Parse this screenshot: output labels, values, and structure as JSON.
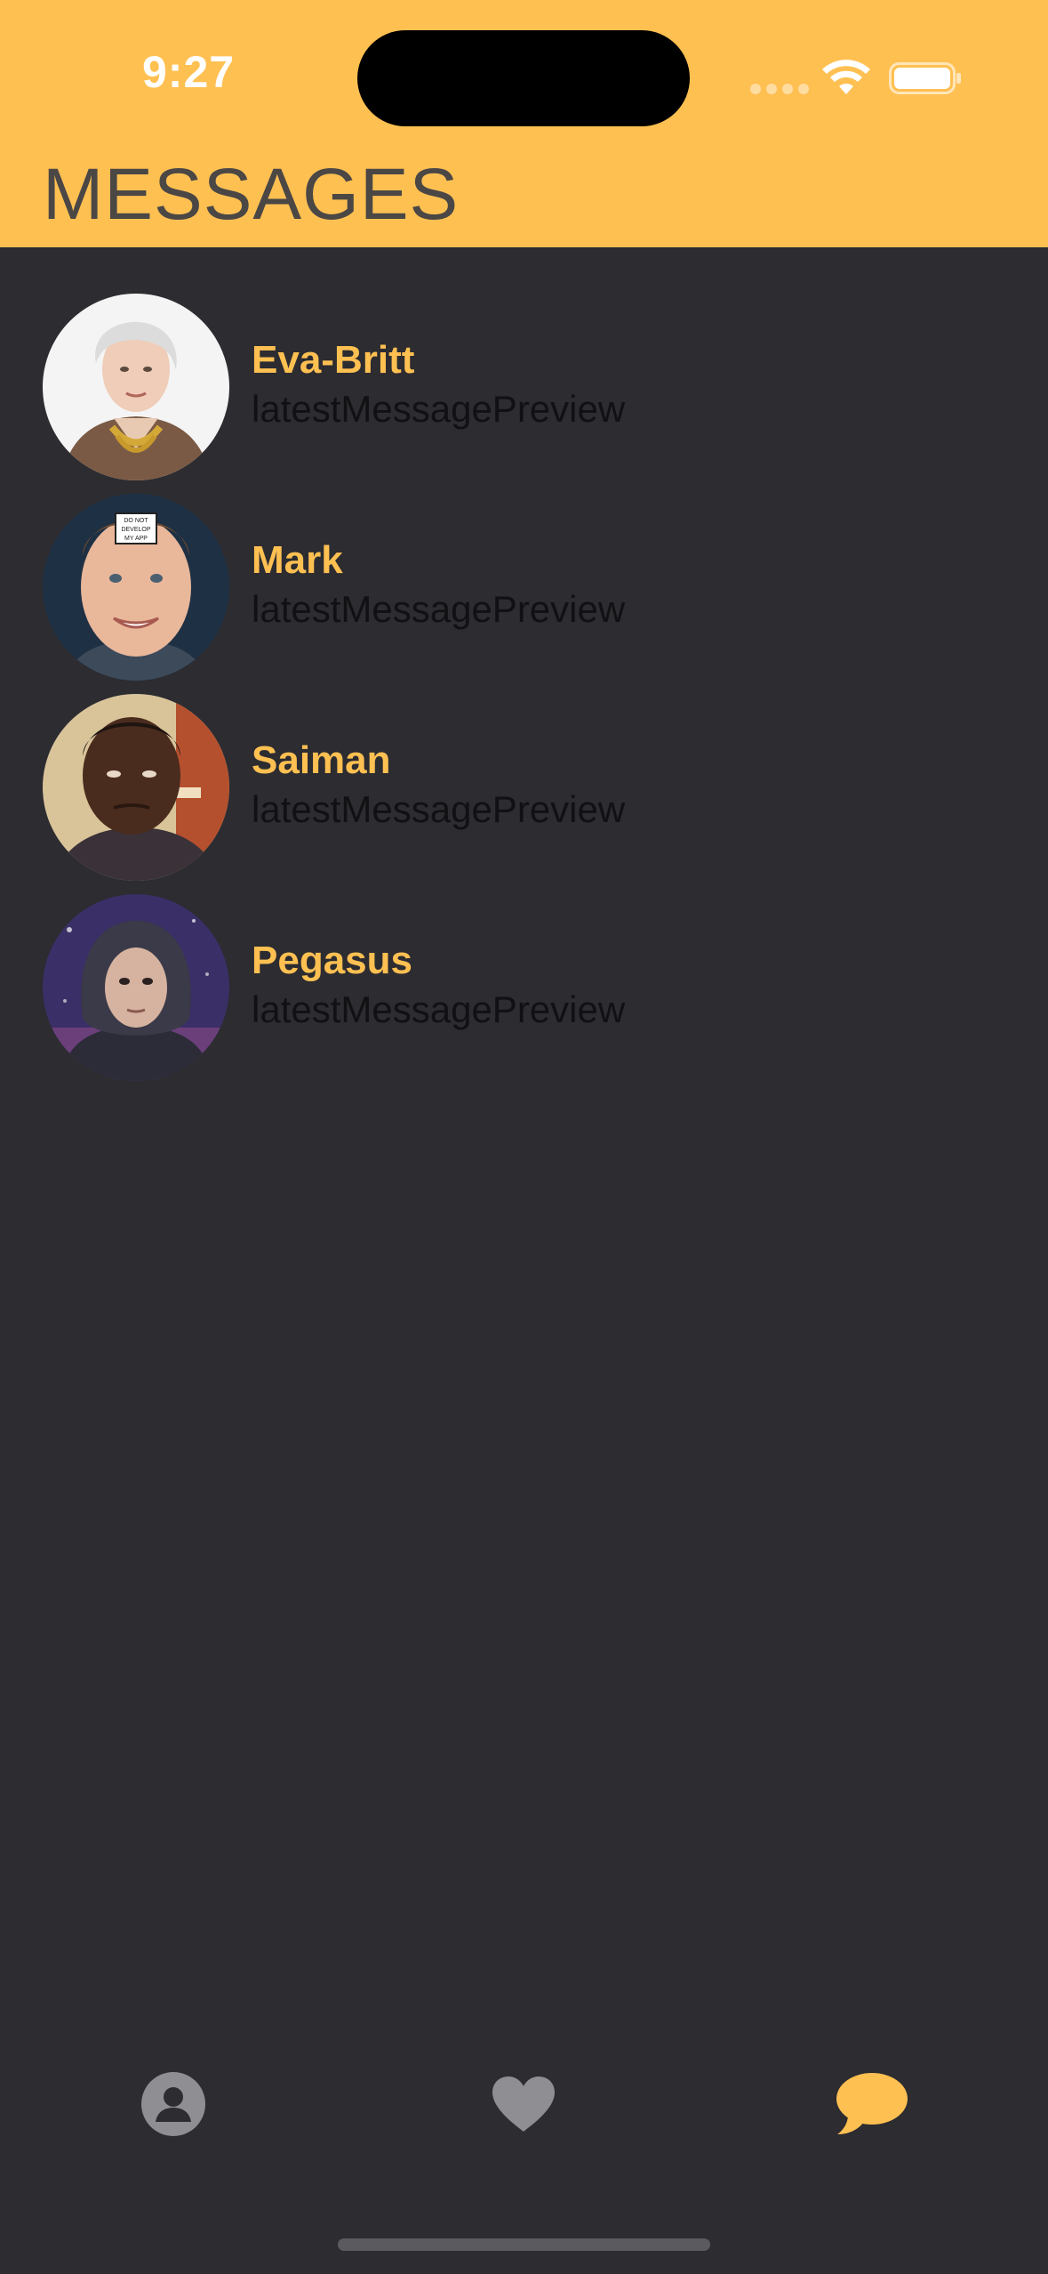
{
  "status_bar": {
    "time": "9:27"
  },
  "header": {
    "title": "MESSAGES",
    "background_color": "#ffc052"
  },
  "conversations": [
    {
      "name": "Eva-Britt",
      "preview": "latestMessagePreview",
      "avatar": "elderly-woman-avatar"
    },
    {
      "name": "Mark",
      "preview": "latestMessagePreview",
      "avatar": "man-with-sign-avatar"
    },
    {
      "name": "Saiman",
      "preview": "latestMessagePreview",
      "avatar": "young-man-avatar"
    },
    {
      "name": "Pegasus",
      "preview": "latestMessagePreview",
      "avatar": "hooded-man-avatar"
    }
  ],
  "avatar_sign_text": [
    "DO NOT",
    "DEVELOP",
    "MY APP"
  ],
  "tab_bar": {
    "tabs": [
      {
        "icon": "person-icon",
        "active": false
      },
      {
        "icon": "heart-icon",
        "active": false
      },
      {
        "icon": "chat-bubble-icon",
        "active": true
      }
    ],
    "active_color": "#ffc052",
    "inactive_color": "#8e8e93"
  },
  "colors": {
    "background": "#2c2c31",
    "accent": "#ffc052",
    "title_text": "#4a4745",
    "preview_text": "#111114"
  }
}
